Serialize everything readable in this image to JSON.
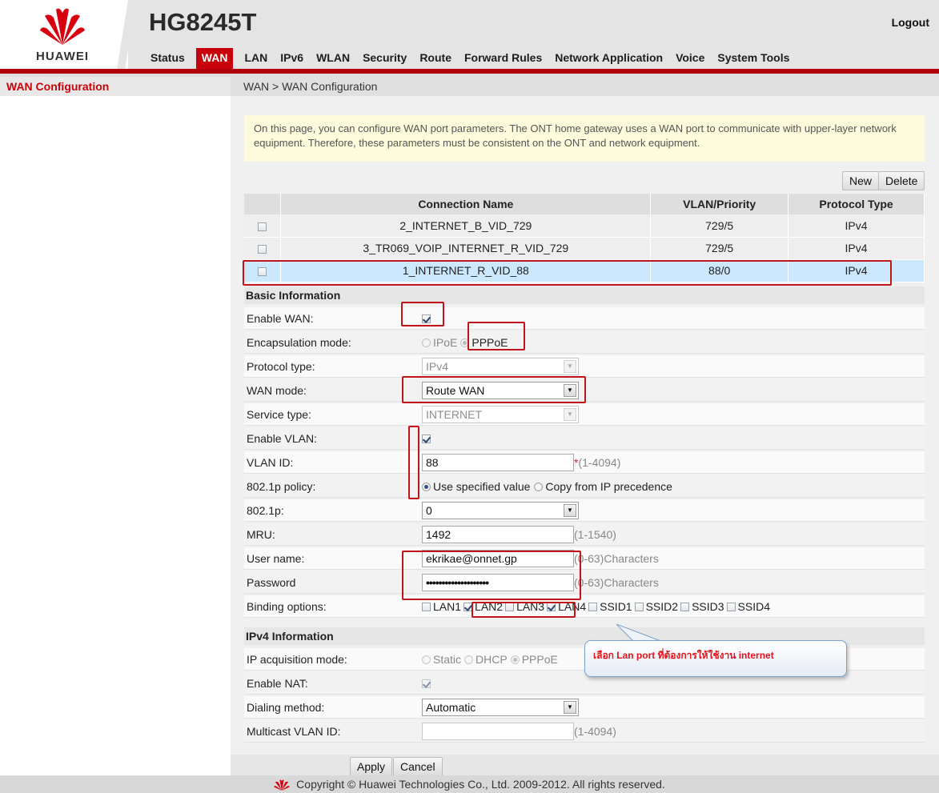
{
  "header": {
    "brand": "HUAWEI",
    "model": "HG8245T",
    "logout": "Logout",
    "nav": [
      "Status",
      "WAN",
      "LAN",
      "IPv6",
      "WLAN",
      "Security",
      "Route",
      "Forward Rules",
      "Network Application",
      "Voice",
      "System Tools"
    ],
    "active_nav": "WAN",
    "accent": "#c7000b"
  },
  "sidebar": {
    "items": [
      "WAN Configuration"
    ]
  },
  "breadcrumb": "WAN > WAN Configuration",
  "info": "On this page, you can configure WAN port parameters. The ONT home gateway uses a WAN port to communicate with upper-layer network equipment. Therefore, these parameters must be consistent on the ONT and network equipment.",
  "buttons": {
    "new": "New",
    "delete": "Delete",
    "apply": "Apply",
    "cancel": "Cancel"
  },
  "table": {
    "headers": [
      "Connection Name",
      "VLAN/Priority",
      "Protocol Type"
    ],
    "rows": [
      {
        "name": "2_INTERNET_B_VID_729",
        "vlan": "729/5",
        "proto": "IPv4"
      },
      {
        "name": "3_TR069_VOIP_INTERNET_R_VID_729",
        "vlan": "729/5",
        "proto": "IPv4"
      },
      {
        "name": "1_INTERNET_R_VID_88",
        "vlan": "88/0",
        "proto": "IPv4"
      }
    ]
  },
  "basic": {
    "title": "Basic Information",
    "enable_wan": "Enable WAN:",
    "encap": {
      "label": "Encapsulation mode:",
      "opt1": "IPoE",
      "opt2": "PPPoE"
    },
    "protocol": {
      "label": "Protocol type:",
      "value": "IPv4"
    },
    "wan_mode": {
      "label": "WAN mode:",
      "value": "Route WAN"
    },
    "service": {
      "label": "Service type:",
      "value": "INTERNET"
    },
    "enable_vlan": "Enable VLAN:",
    "vlan_id": {
      "label": "VLAN ID:",
      "value": "88",
      "star": "*",
      "hint": "(1-4094)"
    },
    "policy": {
      "label": "802.1p policy:",
      "opt1": "Use specified value",
      "opt2": "Copy from IP precedence"
    },
    "p8021": {
      "label": "802.1p:",
      "value": "0"
    },
    "mru": {
      "label": "MRU:",
      "value": "1492",
      "hint": "(1-1540)"
    },
    "username": {
      "label": "User name:",
      "value": "ekrikae@onnet.gp",
      "hint": "(0-63)Characters"
    },
    "password": {
      "label": "Password",
      "value": "••••••••••••••••••••",
      "hint": "(0-63)Characters"
    },
    "binding": {
      "label": "Binding options:",
      "opts": [
        "LAN1",
        "LAN2",
        "LAN3",
        "LAN4",
        "SSID1",
        "SSID2",
        "SSID3",
        "SSID4"
      ]
    }
  },
  "ipv4": {
    "title": "IPv4 Information",
    "acq": {
      "label": "IP acquisition mode:",
      "opt1": "Static",
      "opt2": "DHCP",
      "opt3": "PPPoE"
    },
    "nat": "Enable NAT:",
    "dial": {
      "label": "Dialing method:",
      "value": "Automatic"
    },
    "mcast": {
      "label": "Multicast VLAN ID:",
      "value": "",
      "hint": "(1-4094)"
    }
  },
  "callout": "เลือก Lan port ที่ต้องการให้ใช้งาน internet",
  "footer": "Copyright © Huawei Technologies Co., Ltd. 2009-2012. All rights reserved."
}
